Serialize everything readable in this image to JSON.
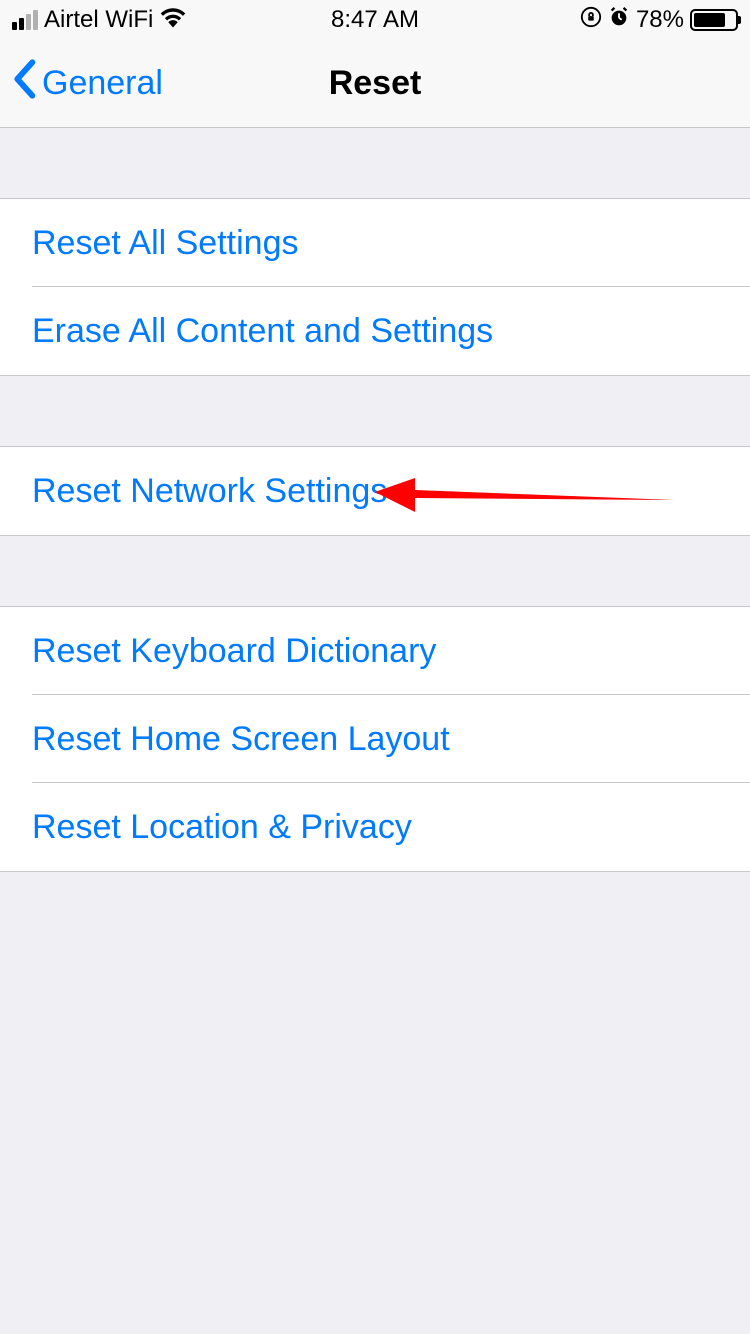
{
  "status_bar": {
    "carrier": "Airtel WiFi",
    "time": "8:47 AM",
    "battery_pct": "78%"
  },
  "nav": {
    "back_label": "General",
    "title": "Reset"
  },
  "sections": [
    {
      "items": [
        {
          "label": "Reset All Settings"
        },
        {
          "label": "Erase All Content and Settings"
        }
      ]
    },
    {
      "items": [
        {
          "label": "Reset Network Settings"
        }
      ]
    },
    {
      "items": [
        {
          "label": "Reset Keyboard Dictionary"
        },
        {
          "label": "Reset Home Screen Layout"
        },
        {
          "label": "Reset Location & Privacy"
        }
      ]
    }
  ]
}
